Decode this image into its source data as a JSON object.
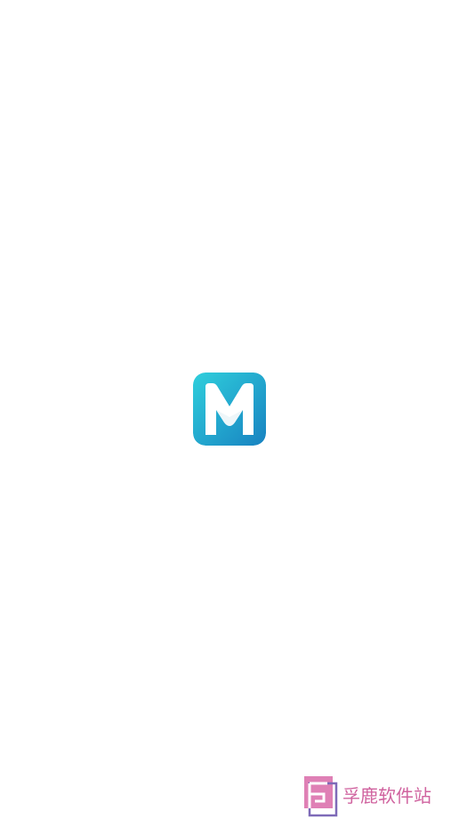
{
  "splash": {
    "logo_icon": "m-letter-app-icon",
    "logo_gradient": [
      "#2ec9d9",
      "#1a86c2"
    ],
    "logo_letter": "M"
  },
  "watermark": {
    "icon": "f-square-logo-icon",
    "text": "孚鹿软件站",
    "color": "#d0639f",
    "accent_color": "#7e6ab8"
  },
  "background_color": "#ffffff"
}
